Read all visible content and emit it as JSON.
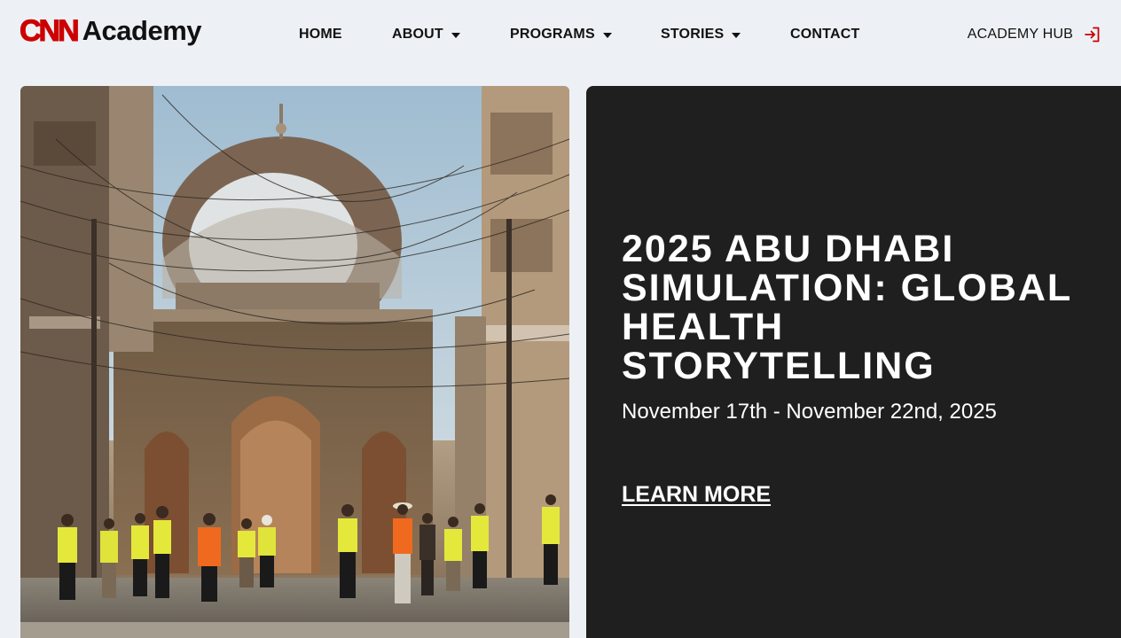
{
  "brand": {
    "logo_mark": "CNN",
    "logo_text": "Academy",
    "brand_color": "#cc0000"
  },
  "nav": {
    "home": "HOME",
    "about": "ABOUT",
    "programs": "PROGRAMS",
    "stories": "STORIES",
    "contact": "CONTACT"
  },
  "hub": {
    "label": "ACADEMY HUB",
    "icon": "sign-in-icon",
    "icon_color": "#cc0000"
  },
  "hero": {
    "image_description": "",
    "title": "2025 ABU DHABI SIMULATION: GLOBAL HEALTH STORYTELLING",
    "date": "November 17th - November 22nd, 2025",
    "cta": "LEARN MORE",
    "card_color": "#1f1f1f"
  }
}
